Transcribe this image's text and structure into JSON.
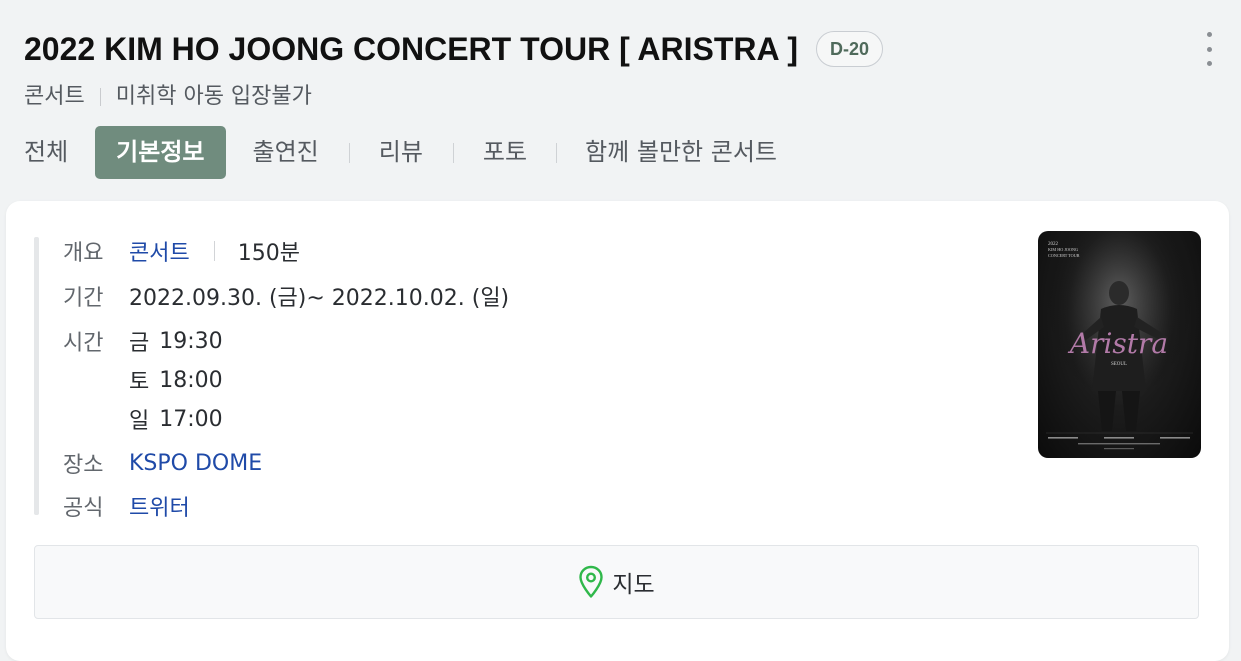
{
  "header": {
    "title": "2022 KIM HO JOONG CONCERT TOUR [ ARISTRA ]",
    "dday": "D-20",
    "category": "콘서트",
    "restriction": "미취학 아동 입장불가"
  },
  "tabs": [
    {
      "label": "전체",
      "active": false
    },
    {
      "label": "기본정보",
      "active": true
    },
    {
      "label": "출연진",
      "active": false
    },
    {
      "label": "리뷰",
      "active": false
    },
    {
      "label": "포토",
      "active": false
    },
    {
      "label": "함께 볼만한 콘서트",
      "active": false
    }
  ],
  "info": {
    "overview_label": "개요",
    "overview_genre": "콘서트",
    "overview_duration": "150분",
    "period_label": "기간",
    "period_value": "2022.09.30. (금)~ 2022.10.02. (일)",
    "time_label": "시간",
    "times": [
      {
        "day": "금",
        "time": "19:30"
      },
      {
        "day": "토",
        "time": "18:00"
      },
      {
        "day": "일",
        "time": "17:00"
      }
    ],
    "venue_label": "장소",
    "venue_value": "KSPO DOME",
    "official_label": "공식",
    "official_value": "트위터"
  },
  "poster": {
    "year": "2022",
    "line1": "KIM HO JOONG",
    "line2": "CONCERT TOUR",
    "script_title": "Aristra",
    "city": "SEOUL"
  },
  "map": {
    "label": "지도"
  },
  "colors": {
    "tab_active_bg": "#708c7e",
    "link": "#1f4aa8",
    "dday_text": "#4f6a5b",
    "map_icon": "#2fb84a"
  }
}
